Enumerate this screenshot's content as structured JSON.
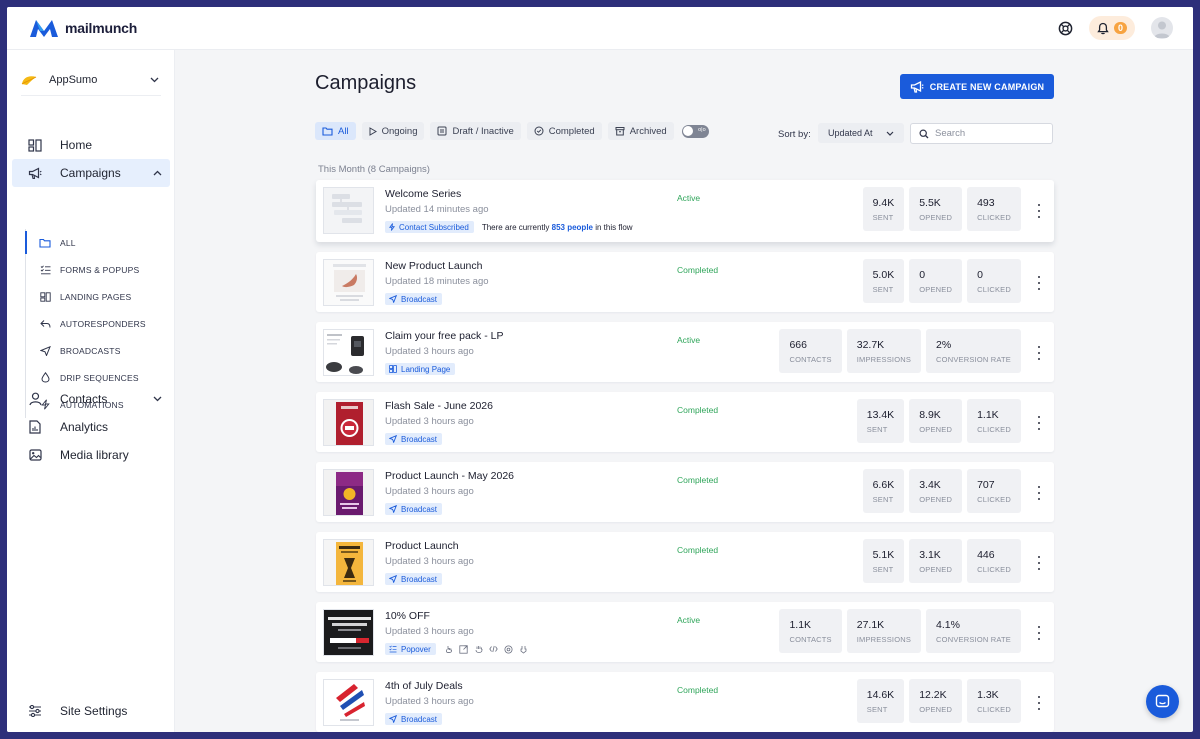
{
  "brand": {
    "name": "mailmunch"
  },
  "header": {
    "notification_count": "0"
  },
  "sidebar": {
    "workspace": "AppSumo",
    "nav": [
      {
        "label": "Home",
        "icon": "dashboard-icon"
      },
      {
        "label": "Campaigns",
        "icon": "megaphone-icon"
      },
      {
        "label": "Contacts",
        "icon": "user-icon"
      },
      {
        "label": "Analytics",
        "icon": "chart-doc-icon"
      },
      {
        "label": "Media library",
        "icon": "image-icon"
      }
    ],
    "campaign_sub": [
      {
        "label": "ALL"
      },
      {
        "label": "FORMS & POPUPS"
      },
      {
        "label": "LANDING PAGES"
      },
      {
        "label": "AUTORESPONDERS"
      },
      {
        "label": "BROADCASTS"
      },
      {
        "label": "DRIP SEQUENCES"
      },
      {
        "label": "AUTOMATIONS"
      }
    ],
    "settings": "Site Settings"
  },
  "main": {
    "title": "Campaigns",
    "create_button": "CREATE NEW CAMPAIGN",
    "filters": [
      "All",
      "Ongoing",
      "Draft / Inactive",
      "Completed",
      "Archived"
    ],
    "toggle_text": "o|o",
    "sort_label": "Sort by:",
    "sort_value": "Updated At",
    "search_placeholder": "Search",
    "group_title": "This Month (8 Campaigns)"
  },
  "campaigns": [
    {
      "name": "Welcome Series",
      "updated": "Updated 14 minutes ago",
      "tag": "Contact Subscribed",
      "note_pre": "There are currently ",
      "note_bold": "853 people",
      "note_post": " in this flow",
      "status": "Active",
      "stats": [
        {
          "v": "9.4K",
          "l": "SENT"
        },
        {
          "v": "5.5K",
          "l": "OPENED"
        },
        {
          "v": "493",
          "l": "CLICKED"
        }
      ]
    },
    {
      "name": "New Product Launch",
      "updated": "Updated 18 minutes ago",
      "tag": "Broadcast",
      "status": "Completed",
      "stats": [
        {
          "v": "5.0K",
          "l": "SENT"
        },
        {
          "v": "0",
          "l": "OPENED"
        },
        {
          "v": "0",
          "l": "CLICKED"
        }
      ]
    },
    {
      "name": "Claim your free pack - LP",
      "updated": "Updated 3 hours ago",
      "tag": "Landing Page",
      "status": "Active",
      "stats": [
        {
          "v": "666",
          "l": "CONTACTS"
        },
        {
          "v": "32.7K",
          "l": "IMPRESSIONS"
        },
        {
          "v": "2%",
          "l": "CONVERSION RATE"
        }
      ]
    },
    {
      "name": "Flash Sale - June 2026",
      "updated": "Updated 3 hours ago",
      "tag": "Broadcast",
      "status": "Completed",
      "stats": [
        {
          "v": "13.4K",
          "l": "SENT"
        },
        {
          "v": "8.9K",
          "l": "OPENED"
        },
        {
          "v": "1.1K",
          "l": "CLICKED"
        }
      ]
    },
    {
      "name": "Product Launch - May 2026",
      "updated": "Updated 3 hours ago",
      "tag": "Broadcast",
      "status": "Completed",
      "stats": [
        {
          "v": "6.6K",
          "l": "SENT"
        },
        {
          "v": "3.4K",
          "l": "OPENED"
        },
        {
          "v": "707",
          "l": "CLICKED"
        }
      ]
    },
    {
      "name": "Product Launch",
      "updated": "Updated 3 hours ago",
      "tag": "Broadcast",
      "status": "Completed",
      "stats": [
        {
          "v": "5.1K",
          "l": "SENT"
        },
        {
          "v": "3.1K",
          "l": "OPENED"
        },
        {
          "v": "446",
          "l": "CLICKED"
        }
      ]
    },
    {
      "name": "10% OFF",
      "updated": "Updated 3 hours ago",
      "tag": "Popover",
      "status": "Active",
      "stats": [
        {
          "v": "1.1K",
          "l": "CONTACTS"
        },
        {
          "v": "27.1K",
          "l": "IMPRESSIONS"
        },
        {
          "v": "4.1%",
          "l": "CONVERSION RATE"
        }
      ]
    },
    {
      "name": "4th of July Deals",
      "updated": "Updated 3 hours ago",
      "tag": "Broadcast",
      "status": "Completed",
      "stats": [
        {
          "v": "14.6K",
          "l": "SENT"
        },
        {
          "v": "12.2K",
          "l": "OPENED"
        },
        {
          "v": "1.3K",
          "l": "CLICKED"
        }
      ]
    }
  ],
  "colors": {
    "accent": "#1a5bdb",
    "active_status": "#2fa55a",
    "frame": "#2d2f7a"
  }
}
